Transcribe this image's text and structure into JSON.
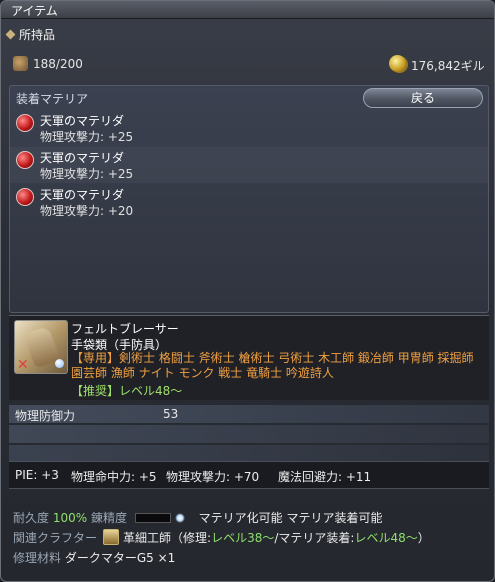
{
  "window": {
    "title": "アイテム"
  },
  "inventory": {
    "section_title": "所持品",
    "count": "188/200",
    "gil": "176,842ギル"
  },
  "materia_panel": {
    "label": "装着マテリア",
    "back_button": "戻る",
    "items": [
      {
        "name": "天軍のマテリダ",
        "stat": "物理攻撃力: +25"
      },
      {
        "name": "天軍のマテリダ",
        "stat": "物理攻撃力: +25"
      },
      {
        "name": "天軍のマテリダ",
        "stat": "物理攻撃力: +20"
      }
    ]
  },
  "item": {
    "name": "フェルトブレーサー",
    "type": "手袋類（手防具）",
    "jobs_tag": "【専用】",
    "jobs": "剣術士 格闘士 斧術士 槍術士 弓術士 木工師 鍛冶師 甲冑師 採掘師 園芸師 漁師 ナイト モンク 戦士 竜騎士 吟遊詩人",
    "level": "【推奨】レベル48～"
  },
  "stats": {
    "physical_defense_label": "物理防御力",
    "physical_defense_value": "53"
  },
  "bonuses": [
    "PIE: +3",
    "物理命中力: +5",
    "物理攻撃力: +70",
    "魔法回避力: +11"
  ],
  "footer": {
    "durability_label": "耐久度",
    "durability_value": "100%",
    "spiritbond_label": "錬精度",
    "meld_text": "マテリア化可能",
    "materia_text": "マテリア装着可能",
    "crafter_label": "関連クラフター",
    "crafter_name": "革細工師",
    "repair_prefix": "（修理:",
    "repair_level": "レベル38～",
    "meld_prefix": "/マテリア装着:",
    "meld_level": "レベル48～",
    "suffix": "）",
    "repair_material_label": "修理材料",
    "repair_material": "ダークマターG5",
    "repair_material_qty": "×1"
  }
}
